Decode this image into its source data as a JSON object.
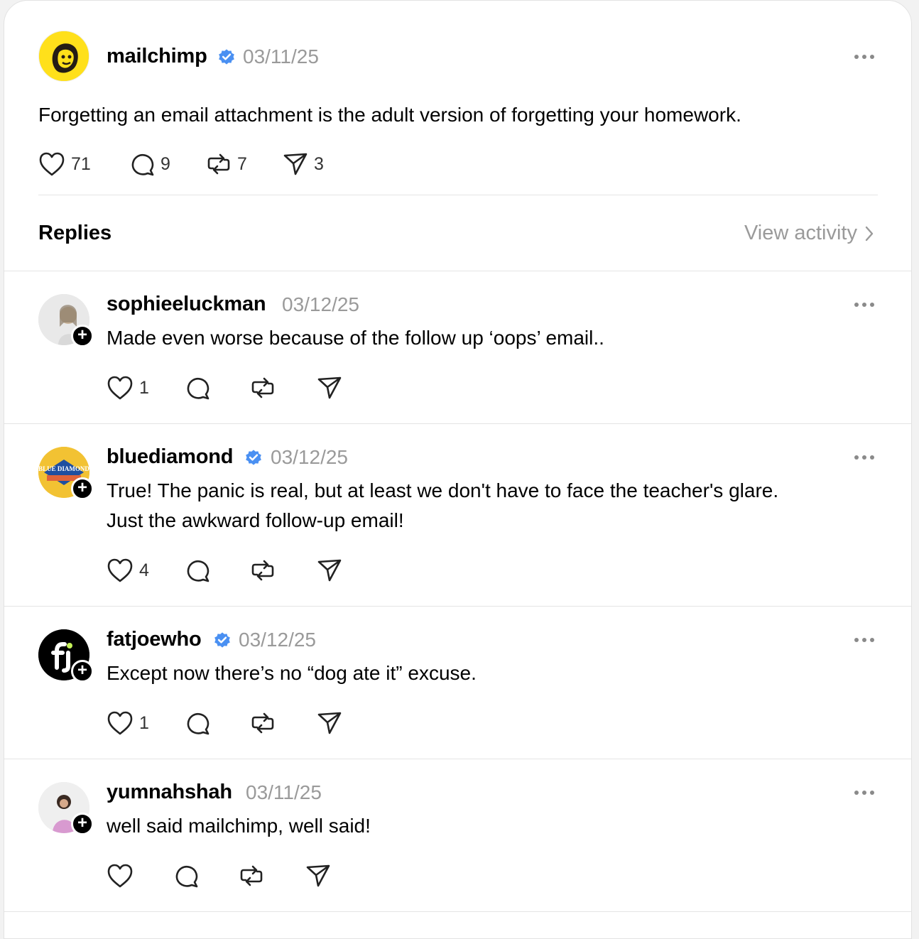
{
  "post": {
    "username": "mailchimp",
    "date": "03/11/25",
    "text": "Forgetting an email attachment is the adult version of forgetting your homework.",
    "likes": "71",
    "replies": "9",
    "reposts": "7",
    "shares": "3"
  },
  "section": {
    "title": "Replies",
    "view_activity": "View activity"
  },
  "replies": [
    {
      "username": "sophieeluckman",
      "verified": false,
      "date": "03/12/25",
      "lines": [
        "Made even worse because of the follow up ‘oops’ email.."
      ],
      "likes": "1"
    },
    {
      "username": "bluediamond",
      "verified": true,
      "date": "03/12/25",
      "lines": [
        "True! The panic is real, but at least we don't have to face the teacher's glare.",
        "Just the awkward follow-up email!"
      ],
      "likes": "4"
    },
    {
      "username": "fatjoewho",
      "verified": true,
      "date": "03/12/25",
      "lines": [
        "Except now there’s no “dog ate it” excuse."
      ],
      "likes": "1"
    },
    {
      "username": "yumnahshah",
      "verified": false,
      "date": "03/11/25",
      "lines": [
        "well said mailchimp, well said!"
      ],
      "likes": ""
    }
  ],
  "icons": {
    "verified_color": "#4a90f2",
    "plus_glyph": "+",
    "avatar_logo_text": "BLUE DIAMOND"
  }
}
